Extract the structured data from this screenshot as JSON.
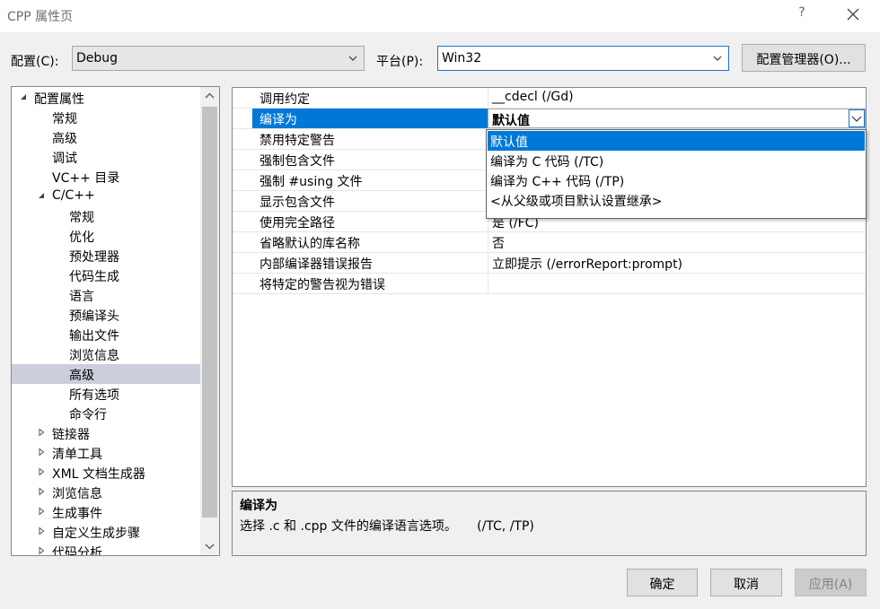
{
  "window": {
    "title": "CPP 属性页",
    "help": "?"
  },
  "toolbar": {
    "config_label": "配置(C):",
    "config_value": "Debug",
    "platform_label": "平台(P):",
    "platform_value": "Win32",
    "manager_button": "配置管理器(O)..."
  },
  "tree": {
    "items": [
      {
        "label": "配置属性",
        "level": 0,
        "state": "expanded"
      },
      {
        "label": "常规",
        "level": 1,
        "state": "leaf"
      },
      {
        "label": "高级",
        "level": 1,
        "state": "leaf"
      },
      {
        "label": "调试",
        "level": 1,
        "state": "leaf"
      },
      {
        "label": "VC++ 目录",
        "level": 1,
        "state": "leaf"
      },
      {
        "label": "C/C++",
        "level": 1,
        "state": "expanded"
      },
      {
        "label": "常规",
        "level": 2,
        "state": "leaf"
      },
      {
        "label": "优化",
        "level": 2,
        "state": "leaf"
      },
      {
        "label": "预处理器",
        "level": 2,
        "state": "leaf"
      },
      {
        "label": "代码生成",
        "level": 2,
        "state": "leaf"
      },
      {
        "label": "语言",
        "level": 2,
        "state": "leaf"
      },
      {
        "label": "预编译头",
        "level": 2,
        "state": "leaf"
      },
      {
        "label": "输出文件",
        "level": 2,
        "state": "leaf"
      },
      {
        "label": "浏览信息",
        "level": 2,
        "state": "leaf"
      },
      {
        "label": "高级",
        "level": 2,
        "state": "leaf",
        "selected": true
      },
      {
        "label": "所有选项",
        "level": 2,
        "state": "leaf"
      },
      {
        "label": "命令行",
        "level": 2,
        "state": "leaf"
      },
      {
        "label": "链接器",
        "level": 1,
        "state": "collapsed"
      },
      {
        "label": "清单工具",
        "level": 1,
        "state": "collapsed"
      },
      {
        "label": "XML 文档生成器",
        "level": 1,
        "state": "collapsed"
      },
      {
        "label": "浏览信息",
        "level": 1,
        "state": "collapsed"
      },
      {
        "label": "生成事件",
        "level": 1,
        "state": "collapsed"
      },
      {
        "label": "自定义生成步骤",
        "level": 1,
        "state": "collapsed"
      },
      {
        "label": "代码分析",
        "level": 1,
        "state": "collapsed"
      }
    ]
  },
  "grid": {
    "rows": [
      {
        "name": "调用约定",
        "value": "__cdecl (/Gd)"
      },
      {
        "name": "编译为",
        "value": "默认值",
        "selected": true
      },
      {
        "name": "禁用特定警告",
        "value": ""
      },
      {
        "name": "强制包含文件",
        "value": ""
      },
      {
        "name": "强制 #using 文件",
        "value": ""
      },
      {
        "name": "显示包含文件",
        "value": ""
      },
      {
        "name": "使用完全路径",
        "value": "是 (/FC)"
      },
      {
        "name": "省略默认的库名称",
        "value": "否"
      },
      {
        "name": "内部编译器错误报告",
        "value": "立即提示 (/errorReport:prompt)"
      },
      {
        "name": "将特定的警告视为错误",
        "value": ""
      }
    ]
  },
  "dropdown": {
    "options": [
      {
        "label": "默认值",
        "selected": true
      },
      {
        "label": "编译为 C 代码 (/TC)"
      },
      {
        "label": "编译为 C++ 代码 (/TP)"
      },
      {
        "label": "<从父级或项目默认设置继承>"
      }
    ]
  },
  "description": {
    "title": "编译为",
    "text": "选择 .c 和 .cpp 文件的编译语言选项。     (/TC, /TP)"
  },
  "buttons": {
    "ok": "确定",
    "cancel": "取消",
    "apply": "应用(A)"
  },
  "colors": {
    "accent": "#0078d7",
    "tree_selection": "#cccedb",
    "background": "#f0f0f0"
  }
}
